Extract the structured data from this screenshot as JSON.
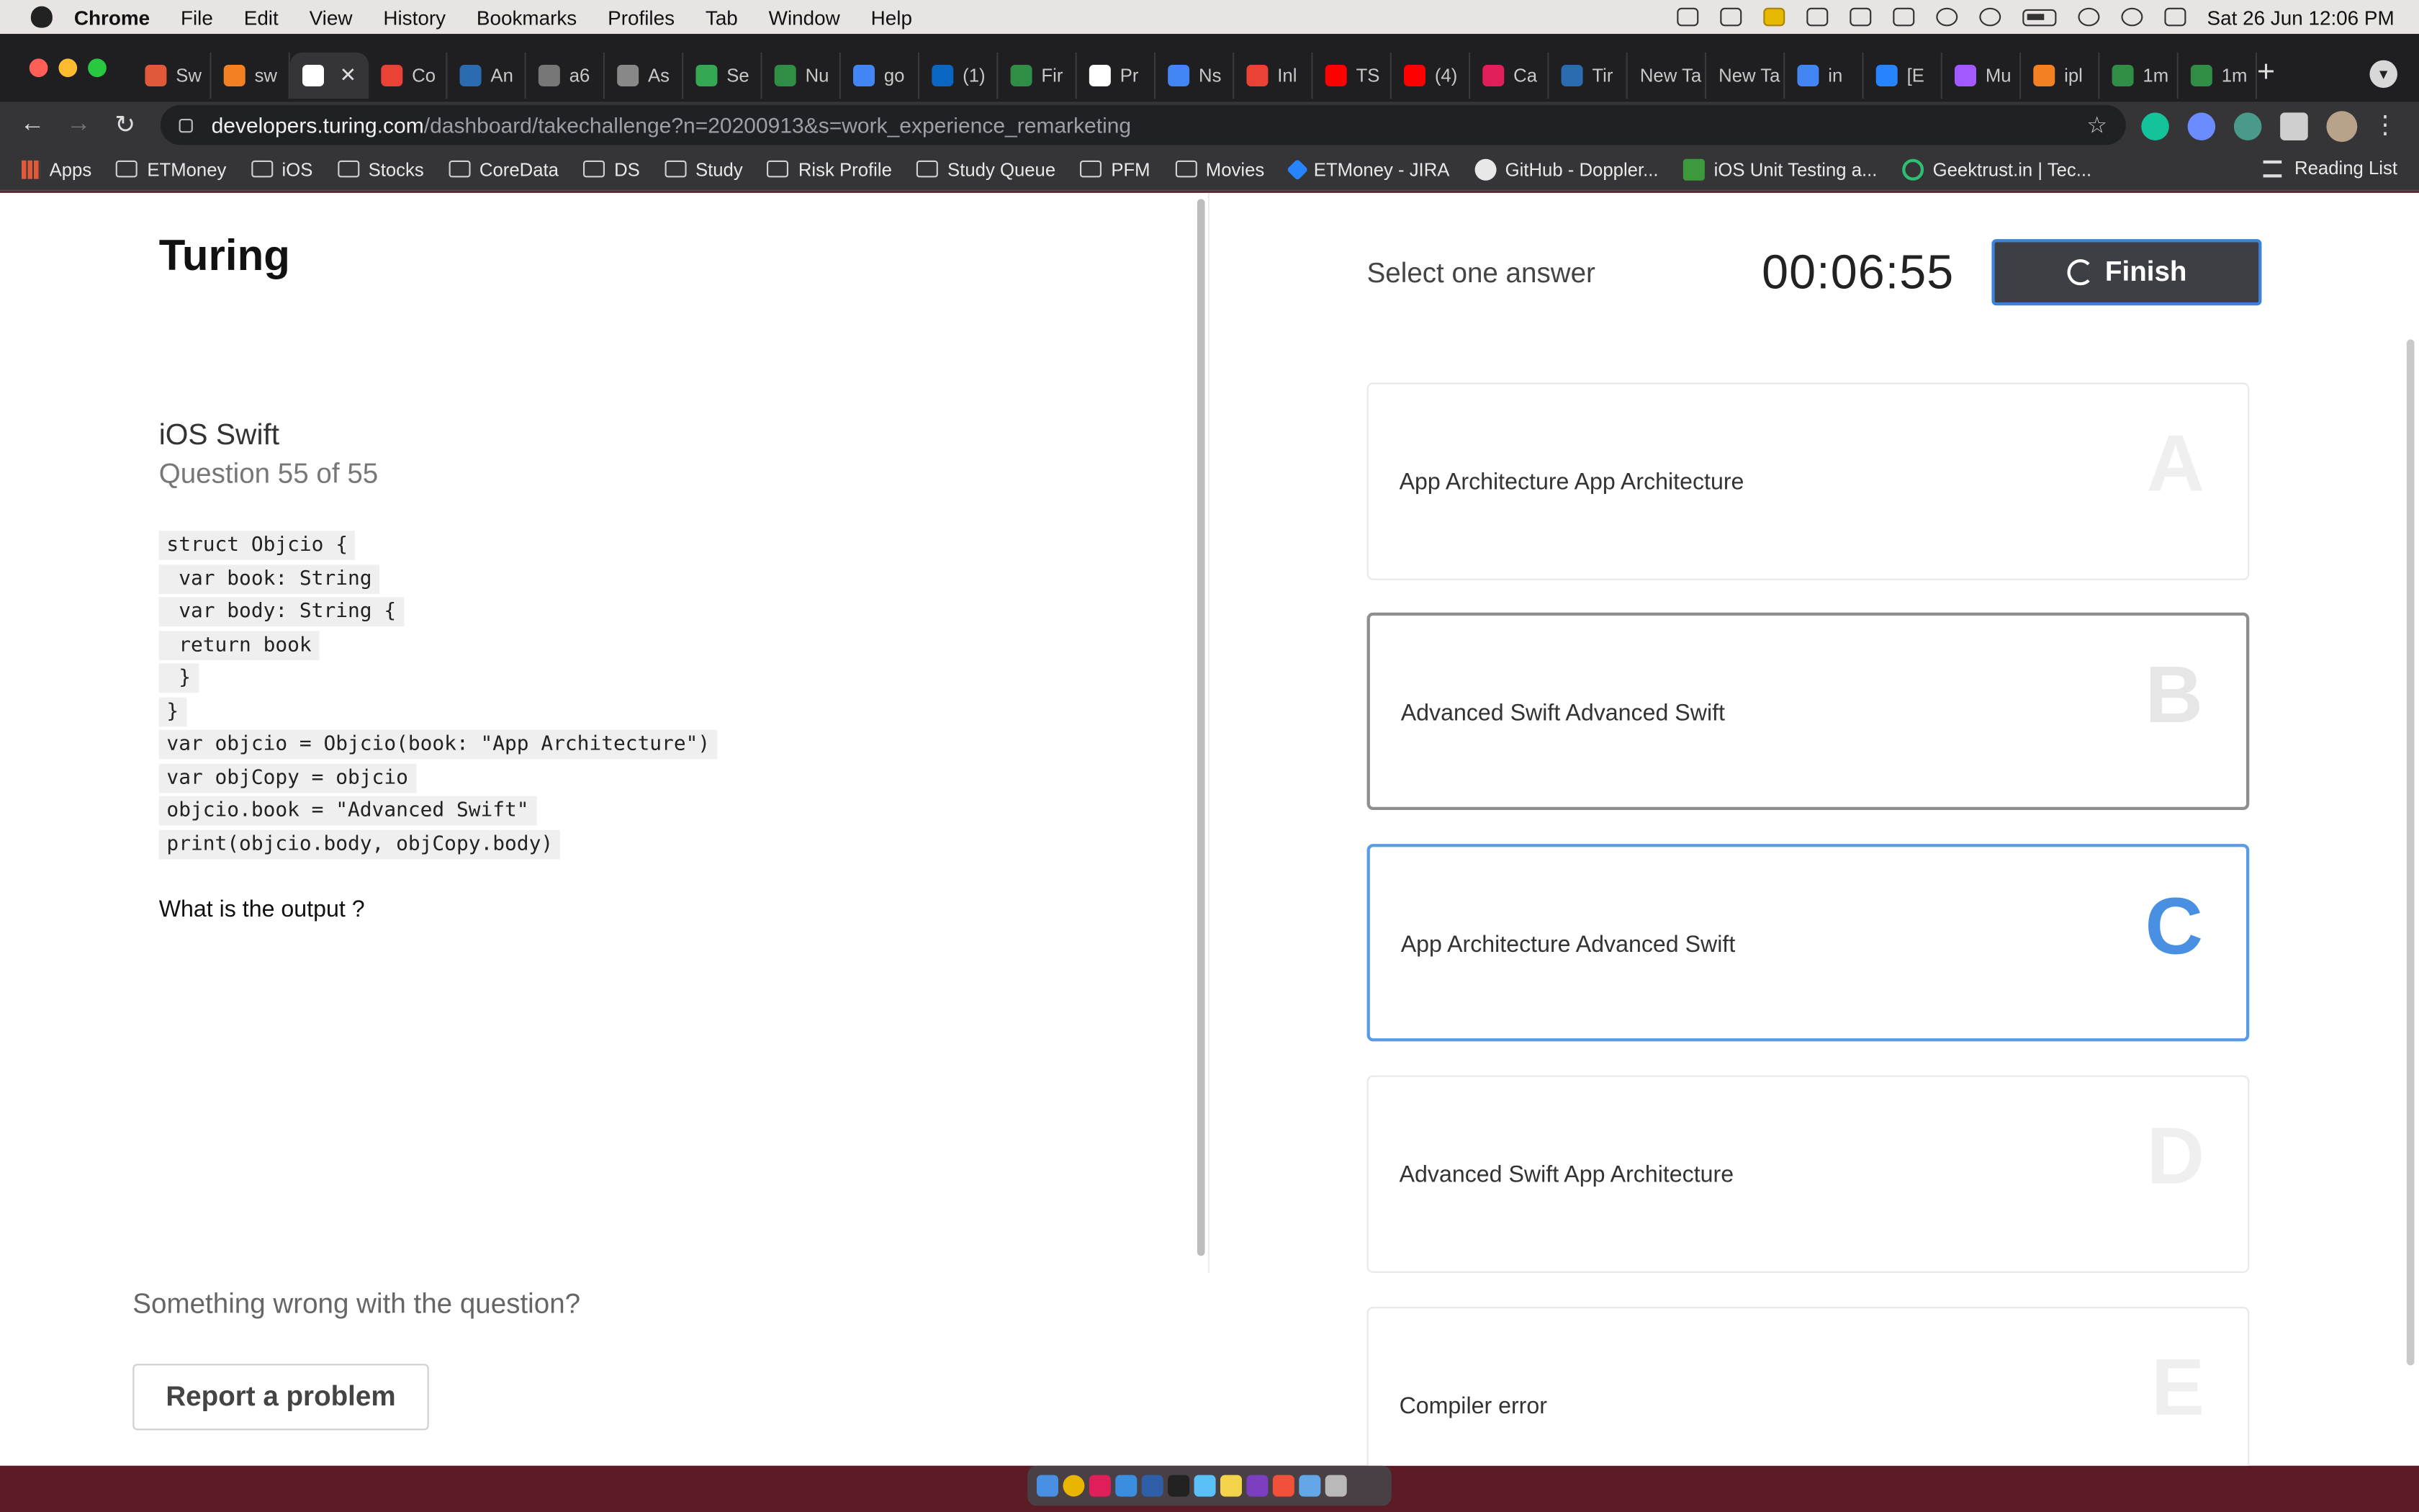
{
  "menubar": {
    "items": [
      "Chrome",
      "File",
      "Edit",
      "View",
      "History",
      "Bookmarks",
      "Profiles",
      "Tab",
      "Window",
      "Help"
    ],
    "datetime": "Sat 26 Jun  12:06 PM"
  },
  "tabs": [
    {
      "label": "Sw",
      "icon": "swift-icon",
      "color": "#e05a3a"
    },
    {
      "label": "sw",
      "icon": "stackoverflow-icon",
      "color": "#f48024"
    },
    {
      "label": "",
      "icon": "turing-icon",
      "color": "#ffffff",
      "active": true
    },
    {
      "label": "Co",
      "icon": "gmail-icon",
      "color": "#ea4335"
    },
    {
      "label": "An",
      "icon": "dict-icon",
      "color": "#2b6cb0"
    },
    {
      "label": "a6",
      "icon": "globe-icon",
      "color": "#777777"
    },
    {
      "label": "As",
      "icon": "doc-icon",
      "color": "#888888"
    },
    {
      "label": "Se",
      "icon": "phone-icon",
      "color": "#34a853"
    },
    {
      "label": "Nu",
      "icon": "geeks-icon",
      "color": "#2f8d46"
    },
    {
      "label": "go",
      "icon": "google-icon",
      "color": "#4285f4"
    },
    {
      "label": "(1)",
      "icon": "linkedin-icon",
      "color": "#0a66c2"
    },
    {
      "label": "Fir",
      "icon": "geeks-icon",
      "color": "#2f8d46"
    },
    {
      "label": "Pr",
      "icon": "medium-icon",
      "color": "#ffffff"
    },
    {
      "label": "Ns",
      "icon": "google-icon",
      "color": "#4285f4"
    },
    {
      "label": "Inl",
      "icon": "gmail-icon",
      "color": "#ea4335"
    },
    {
      "label": "TS",
      "icon": "youtube-icon",
      "color": "#ff0000"
    },
    {
      "label": "(4)",
      "icon": "youtube-icon",
      "color": "#ff0000"
    },
    {
      "label": "Ca",
      "icon": "slack-icon",
      "color": "#e01e5a"
    },
    {
      "label": "Tir",
      "icon": "dict-icon",
      "color": "#2b6cb0"
    },
    {
      "label": "New Ta",
      "icon": "",
      "color": ""
    },
    {
      "label": "New Ta",
      "icon": "",
      "color": ""
    },
    {
      "label": "in",
      "icon": "google-icon",
      "color": "#4285f4"
    },
    {
      "label": "[E",
      "icon": "jira-icon",
      "color": "#2684ff"
    },
    {
      "label": "Mu",
      "icon": "figma-icon",
      "color": "#a259ff"
    },
    {
      "label": "ipl",
      "icon": "stackoverflow-icon",
      "color": "#f48024"
    },
    {
      "label": "1m",
      "icon": "geeks-icon",
      "color": "#2f8d46"
    },
    {
      "label": "1m",
      "icon": "geeks-icon",
      "color": "#2f8d46"
    }
  ],
  "omnibox": {
    "host": "developers.turing.com",
    "path": "/dashboard/takechallenge?n=20200913&s=work_experience_remarketing"
  },
  "bookmarks": {
    "apps": "Apps",
    "items": [
      "ETMoney",
      "iOS",
      "Stocks",
      "CoreData",
      "DS",
      "Study",
      "Risk Profile",
      "Study Queue",
      "PFM",
      "Movies"
    ],
    "jira": "ETMoney - JIRA",
    "github": "GitHub - Doppler...",
    "unit": "iOS Unit Testing a...",
    "geektrust": "Geektrust.in | Tec...",
    "reading_list": "Reading List"
  },
  "question": {
    "brand": "Turing",
    "subject": "iOS Swift",
    "number": "Question 55 of 55",
    "code_lines": [
      "struct Objcio {",
      " var book: String",
      " var body: String {",
      " return book",
      " }",
      "}",
      "var objcio = Objcio(book: \"App Architecture\")",
      "var objCopy = objcio",
      "objcio.book = \"Advanced Swift\"",
      "print(objcio.body, objCopy.body)"
    ],
    "prompt": "What is the output ?",
    "wrong_text": "Something wrong with the question?",
    "report_label": "Report a problem"
  },
  "answers": {
    "instruction": "Select one answer",
    "timer": "00:06:55",
    "finish_label": "Finish",
    "selected": "C",
    "hovered": "B",
    "options": [
      {
        "letter": "A",
        "text": "App Architecture App Architecture"
      },
      {
        "letter": "B",
        "text": "Advanced Swift Advanced Swift"
      },
      {
        "letter": "C",
        "text": "App Architecture Advanced Swift"
      },
      {
        "letter": "D",
        "text": "Advanced Swift App Architecture"
      },
      {
        "letter": "E",
        "text": "Compiler error"
      }
    ]
  },
  "colors": {
    "accent": "#4a90e2",
    "finish_bg": "#3d3f45"
  }
}
